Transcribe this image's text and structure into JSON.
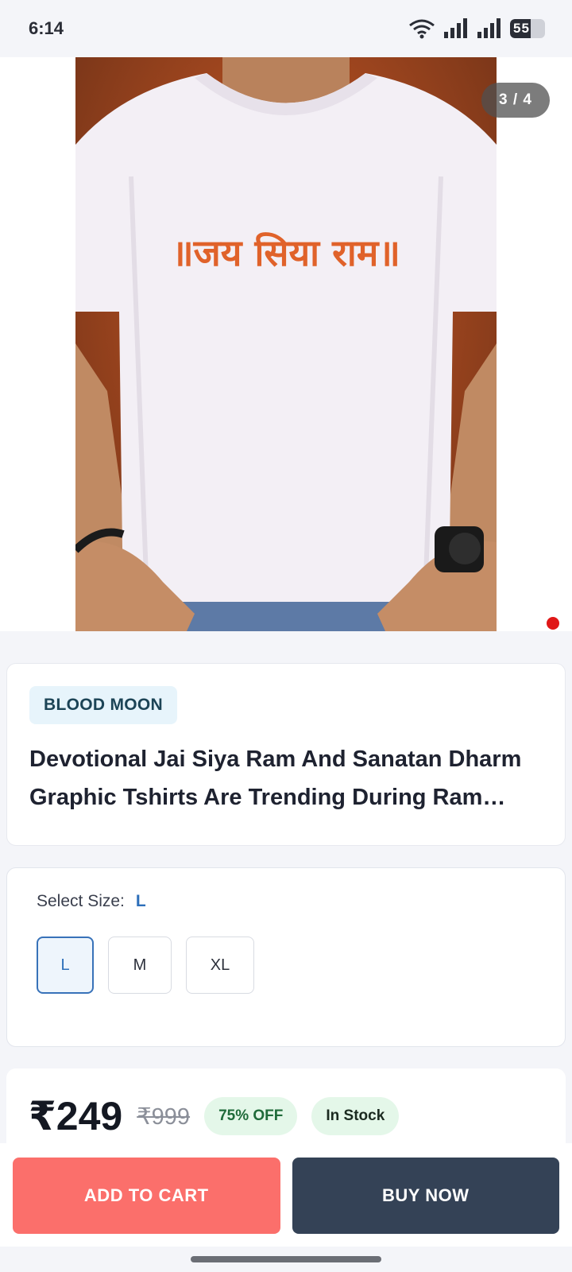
{
  "status_bar": {
    "time": "6:14",
    "battery": "55"
  },
  "gallery": {
    "counter": "3 / 4",
    "print_text": "॥जय सिया राम॥"
  },
  "product": {
    "brand": "BLOOD MOON",
    "title": "Devotional Jai Siya Ram And Sanatan Dharm Graphic Tshirts Are Trending During Ram Navami"
  },
  "size_selector": {
    "label": "Select Size:",
    "selected": "L",
    "options": [
      "L",
      "M",
      "XL"
    ]
  },
  "pricing": {
    "price": "₹249",
    "mrp": "₹999",
    "discount": "75% OFF",
    "stock": "In Stock"
  },
  "actions": {
    "add_to_cart": "ADD TO CART",
    "buy_now": "BUY NOW"
  },
  "colors": {
    "add_to_cart": "#fb6f6b",
    "buy_now": "#344256",
    "accent": "#2d6fba",
    "pagination_dot": "#e01717"
  },
  "icons": [
    "wifi-icon",
    "signal-icon",
    "battery-icon"
  ]
}
